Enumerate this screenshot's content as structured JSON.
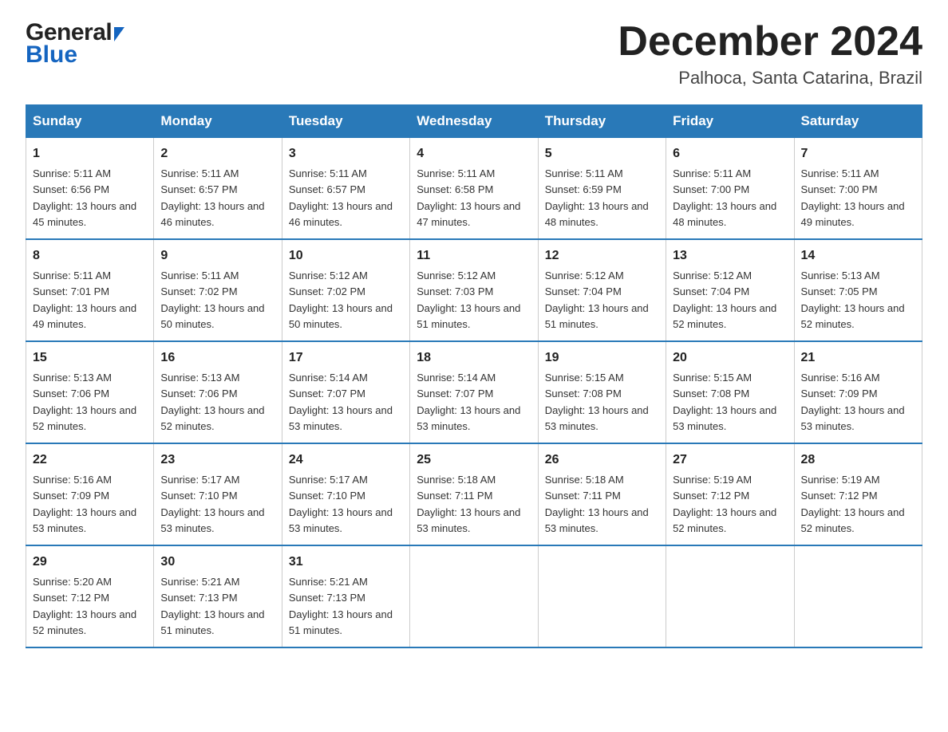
{
  "logo": {
    "general": "General",
    "blue": "Blue"
  },
  "title": {
    "month_year": "December 2024",
    "location": "Palhoca, Santa Catarina, Brazil"
  },
  "headers": [
    "Sunday",
    "Monday",
    "Tuesday",
    "Wednesday",
    "Thursday",
    "Friday",
    "Saturday"
  ],
  "weeks": [
    [
      {
        "day": "1",
        "sunrise": "5:11 AM",
        "sunset": "6:56 PM",
        "daylight": "13 hours and 45 minutes."
      },
      {
        "day": "2",
        "sunrise": "5:11 AM",
        "sunset": "6:57 PM",
        "daylight": "13 hours and 46 minutes."
      },
      {
        "day": "3",
        "sunrise": "5:11 AM",
        "sunset": "6:57 PM",
        "daylight": "13 hours and 46 minutes."
      },
      {
        "day": "4",
        "sunrise": "5:11 AM",
        "sunset": "6:58 PM",
        "daylight": "13 hours and 47 minutes."
      },
      {
        "day": "5",
        "sunrise": "5:11 AM",
        "sunset": "6:59 PM",
        "daylight": "13 hours and 48 minutes."
      },
      {
        "day": "6",
        "sunrise": "5:11 AM",
        "sunset": "7:00 PM",
        "daylight": "13 hours and 48 minutes."
      },
      {
        "day": "7",
        "sunrise": "5:11 AM",
        "sunset": "7:00 PM",
        "daylight": "13 hours and 49 minutes."
      }
    ],
    [
      {
        "day": "8",
        "sunrise": "5:11 AM",
        "sunset": "7:01 PM",
        "daylight": "13 hours and 49 minutes."
      },
      {
        "day": "9",
        "sunrise": "5:11 AM",
        "sunset": "7:02 PM",
        "daylight": "13 hours and 50 minutes."
      },
      {
        "day": "10",
        "sunrise": "5:12 AM",
        "sunset": "7:02 PM",
        "daylight": "13 hours and 50 minutes."
      },
      {
        "day": "11",
        "sunrise": "5:12 AM",
        "sunset": "7:03 PM",
        "daylight": "13 hours and 51 minutes."
      },
      {
        "day": "12",
        "sunrise": "5:12 AM",
        "sunset": "7:04 PM",
        "daylight": "13 hours and 51 minutes."
      },
      {
        "day": "13",
        "sunrise": "5:12 AM",
        "sunset": "7:04 PM",
        "daylight": "13 hours and 52 minutes."
      },
      {
        "day": "14",
        "sunrise": "5:13 AM",
        "sunset": "7:05 PM",
        "daylight": "13 hours and 52 minutes."
      }
    ],
    [
      {
        "day": "15",
        "sunrise": "5:13 AM",
        "sunset": "7:06 PM",
        "daylight": "13 hours and 52 minutes."
      },
      {
        "day": "16",
        "sunrise": "5:13 AM",
        "sunset": "7:06 PM",
        "daylight": "13 hours and 52 minutes."
      },
      {
        "day": "17",
        "sunrise": "5:14 AM",
        "sunset": "7:07 PM",
        "daylight": "13 hours and 53 minutes."
      },
      {
        "day": "18",
        "sunrise": "5:14 AM",
        "sunset": "7:07 PM",
        "daylight": "13 hours and 53 minutes."
      },
      {
        "day": "19",
        "sunrise": "5:15 AM",
        "sunset": "7:08 PM",
        "daylight": "13 hours and 53 minutes."
      },
      {
        "day": "20",
        "sunrise": "5:15 AM",
        "sunset": "7:08 PM",
        "daylight": "13 hours and 53 minutes."
      },
      {
        "day": "21",
        "sunrise": "5:16 AM",
        "sunset": "7:09 PM",
        "daylight": "13 hours and 53 minutes."
      }
    ],
    [
      {
        "day": "22",
        "sunrise": "5:16 AM",
        "sunset": "7:09 PM",
        "daylight": "13 hours and 53 minutes."
      },
      {
        "day": "23",
        "sunrise": "5:17 AM",
        "sunset": "7:10 PM",
        "daylight": "13 hours and 53 minutes."
      },
      {
        "day": "24",
        "sunrise": "5:17 AM",
        "sunset": "7:10 PM",
        "daylight": "13 hours and 53 minutes."
      },
      {
        "day": "25",
        "sunrise": "5:18 AM",
        "sunset": "7:11 PM",
        "daylight": "13 hours and 53 minutes."
      },
      {
        "day": "26",
        "sunrise": "5:18 AM",
        "sunset": "7:11 PM",
        "daylight": "13 hours and 53 minutes."
      },
      {
        "day": "27",
        "sunrise": "5:19 AM",
        "sunset": "7:12 PM",
        "daylight": "13 hours and 52 minutes."
      },
      {
        "day": "28",
        "sunrise": "5:19 AM",
        "sunset": "7:12 PM",
        "daylight": "13 hours and 52 minutes."
      }
    ],
    [
      {
        "day": "29",
        "sunrise": "5:20 AM",
        "sunset": "7:12 PM",
        "daylight": "13 hours and 52 minutes."
      },
      {
        "day": "30",
        "sunrise": "5:21 AM",
        "sunset": "7:13 PM",
        "daylight": "13 hours and 51 minutes."
      },
      {
        "day": "31",
        "sunrise": "5:21 AM",
        "sunset": "7:13 PM",
        "daylight": "13 hours and 51 minutes."
      },
      null,
      null,
      null,
      null
    ]
  ]
}
